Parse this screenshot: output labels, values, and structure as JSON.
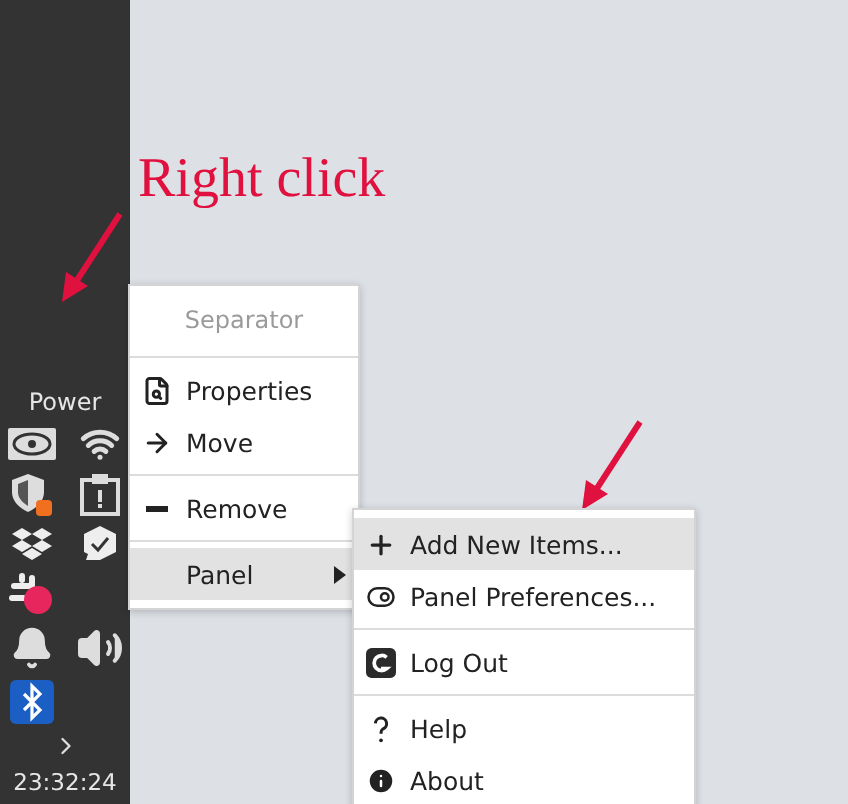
{
  "panel": {
    "label": "Power",
    "clock": "23:32:24"
  },
  "annotation": {
    "text": "Right click"
  },
  "context_menu": {
    "items": [
      {
        "kind": "header",
        "label": "Separator"
      },
      {
        "kind": "separator"
      },
      {
        "kind": "item",
        "label": "Properties",
        "selected": false
      },
      {
        "kind": "item",
        "label": "Move",
        "selected": false
      },
      {
        "kind": "separator"
      },
      {
        "kind": "item",
        "label": "Remove",
        "selected": false
      },
      {
        "kind": "separator"
      },
      {
        "kind": "submenu",
        "label": "Panel",
        "selected": true
      }
    ]
  },
  "submenu": {
    "items": [
      {
        "kind": "item",
        "label": "Add New Items...",
        "selected": true
      },
      {
        "kind": "item",
        "label": "Panel Preferences...",
        "selected": false
      },
      {
        "kind": "separator"
      },
      {
        "kind": "item",
        "label": "Log Out",
        "selected": false
      },
      {
        "kind": "separator"
      },
      {
        "kind": "item",
        "label": "Help",
        "selected": false
      },
      {
        "kind": "item",
        "label": "About",
        "selected": false
      }
    ]
  }
}
